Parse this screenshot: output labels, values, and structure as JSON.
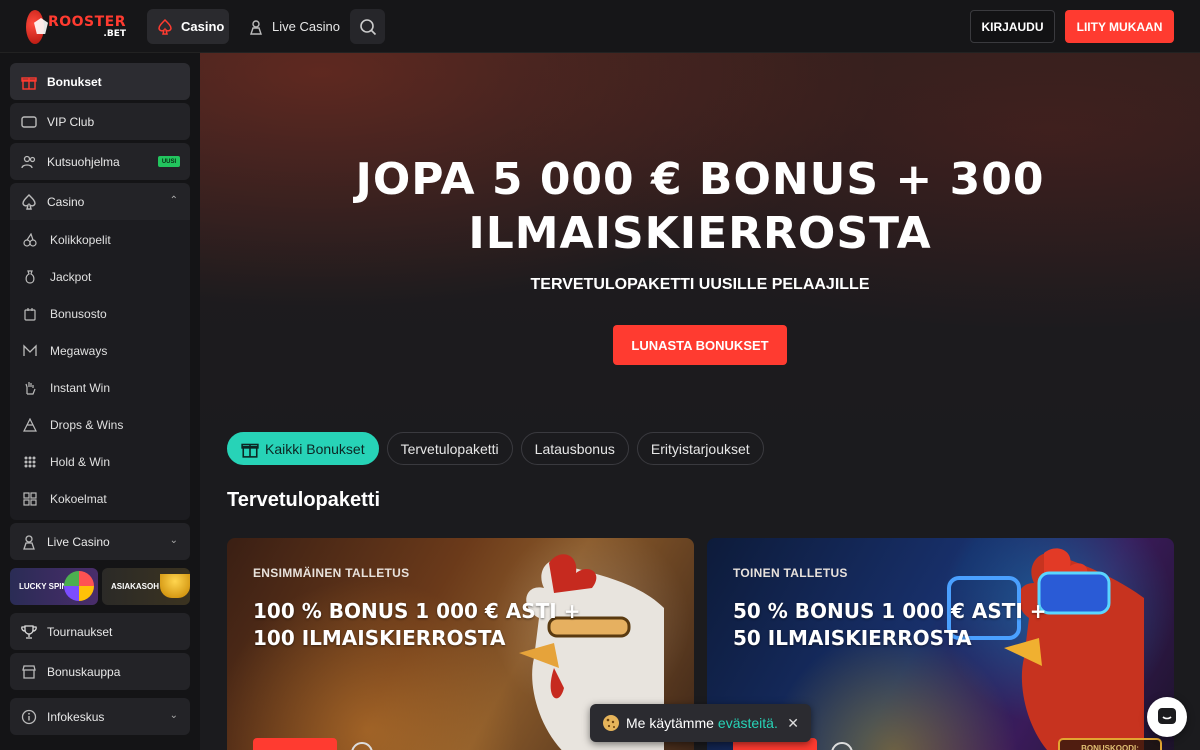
{
  "brand": {
    "name": "ROOSTER",
    "suffix": ".BET"
  },
  "header": {
    "nav": [
      {
        "label": "Casino"
      },
      {
        "label": "Live Casino"
      }
    ],
    "login_label": "KIRJAUDU",
    "join_label": "LIITY MUKAAN"
  },
  "sidebar": {
    "items": [
      {
        "label": "Bonukset"
      },
      {
        "label": "VIP Club"
      },
      {
        "label": "Kutsuohjelma",
        "badge": "UUSI"
      },
      {
        "label": "Casino"
      }
    ],
    "casino_sub": [
      {
        "label": "Kolikkopelit"
      },
      {
        "label": "Jackpot"
      },
      {
        "label": "Bonusosto"
      },
      {
        "label": "Megaways"
      },
      {
        "label": "Instant Win"
      },
      {
        "label": "Drops & Wins"
      },
      {
        "label": "Hold & Win"
      },
      {
        "label": "Kokoelmat"
      }
    ],
    "live_casino": "Live Casino",
    "promos": [
      {
        "label": "LUCKY SPIN"
      },
      {
        "label": "ASIAKASOH"
      }
    ],
    "bottom": [
      {
        "label": "Tournaukset"
      },
      {
        "label": "Bonuskauppa"
      },
      {
        "label": "Infokeskus"
      }
    ]
  },
  "hero": {
    "title_line1": "JOPA 5 000 € BONUS + 300",
    "title_line2": "ILMAISKIERROSTA",
    "subtitle": "TERVETULOPAKETTI UUSILLE PELAAJILLE",
    "cta": "LUNASTA BONUKSET"
  },
  "filters": [
    {
      "label": "Kaikki Bonukset",
      "active": true
    },
    {
      "label": "Tervetulopaketti",
      "active": false
    },
    {
      "label": "Latausbonus",
      "active": false
    },
    {
      "label": "Erityistarjoukset",
      "active": false
    }
  ],
  "section_title": "Tervetulopaketti",
  "cards": [
    {
      "eyebrow": "ENSIMMÄINEN TALLETUS",
      "title_line1": "100 % BONUS 1 000 € ASTI +",
      "title_line2": "100 ILMAISKIERROSTA"
    },
    {
      "eyebrow": "TOINEN TALLETUS",
      "title_line1": "50 % BONUS 1 000 € ASTI +",
      "title_line2": "50 ILMAISKIERROSTA",
      "code_label": "BONUSKOODI:"
    }
  ],
  "cookie": {
    "text": "Me käytämme",
    "link": "evästeitä."
  },
  "colors": {
    "accent_red": "#ff3b30",
    "accent_teal": "#27d3b7",
    "badge_green": "#22c55e"
  }
}
